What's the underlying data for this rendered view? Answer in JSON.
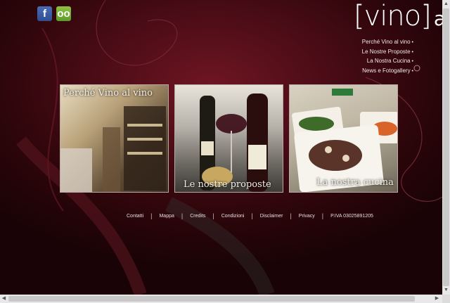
{
  "social": {
    "facebook_glyph": "f",
    "tripadvisor_glyph": "oo"
  },
  "logo": {
    "bracket_text": "[vino]",
    "suffix_text": "al vi"
  },
  "nav": {
    "items": [
      {
        "label": "Perché Vino al vino"
      },
      {
        "label": "Le Nostre Proposte"
      },
      {
        "label": "La Nostra Cucina"
      },
      {
        "label": "News e Fotogallery"
      }
    ]
  },
  "tiles": [
    {
      "caption": "Perché Vino al vino"
    },
    {
      "caption": "Le nostre proposte"
    },
    {
      "caption": "La nostra cucina"
    }
  ],
  "footer": {
    "links": [
      "Contatti",
      "Mappa",
      "Credits",
      "Condizioni",
      "Disclaimer",
      "Privacy"
    ],
    "vat": "P.IVA 03025891205"
  },
  "colors": {
    "background": "#4a0c16",
    "text": "#f0e6e6"
  }
}
